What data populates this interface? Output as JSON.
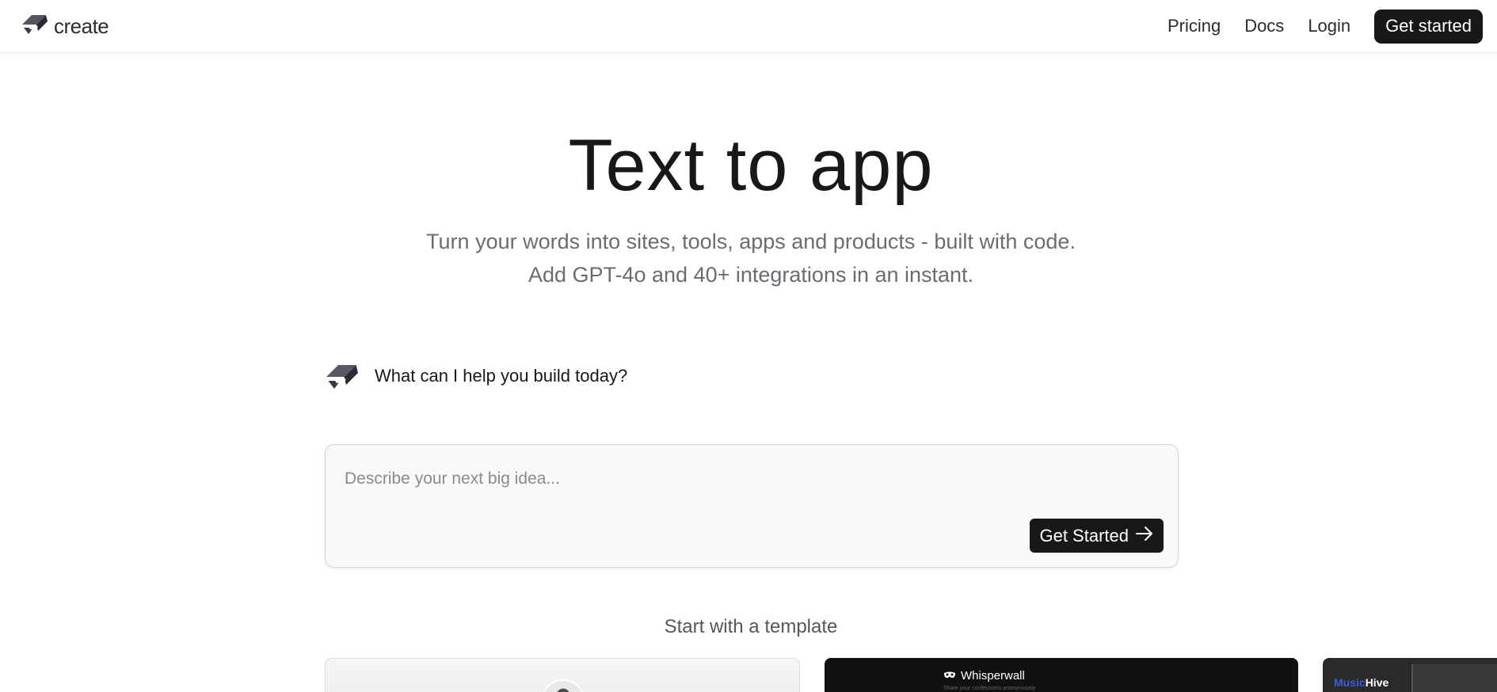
{
  "brand": {
    "name": "create",
    "logo_icon": "create-logo-icon"
  },
  "nav": {
    "pricing": "Pricing",
    "docs": "Docs",
    "login": "Login",
    "get_started": "Get started"
  },
  "hero": {
    "title": "Text to app",
    "subtitle_line1": "Turn your words into sites, tools, apps and products - built with code.",
    "subtitle_line2": "Add GPT-4o and 40+ integrations in an instant."
  },
  "assistant": {
    "prompt": "What can I help you build today?"
  },
  "idea_box": {
    "placeholder": "Describe your next big idea...",
    "value": "",
    "submit_label": "Get Started"
  },
  "templates": {
    "heading": "Start with a template",
    "cards": [
      {
        "title": ""
      },
      {
        "title": "Whisperwall",
        "subtitle": "Share your confessions anonymously"
      },
      {
        "title_accent": "Music",
        "title": "Hive"
      }
    ]
  },
  "colors": {
    "primary": "#18181b",
    "text_muted": "#6b6b72",
    "border": "#d4d4d8",
    "input_bg": "#f9f9f9",
    "accent_blue": "#3b5bdb"
  }
}
